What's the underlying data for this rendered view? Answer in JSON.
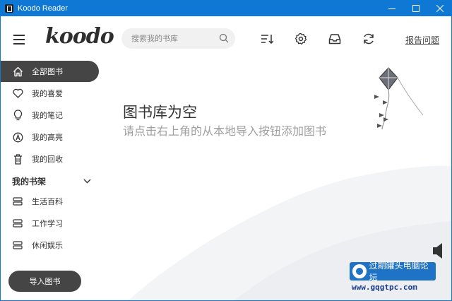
{
  "window": {
    "title": "Koodo Reader"
  },
  "header": {
    "logo": "koodo",
    "search_placeholder": "搜索我的书库",
    "report_label": "报告问题"
  },
  "sidebar": {
    "items": [
      {
        "label": "全部图书",
        "icon": "home-icon",
        "active": true
      },
      {
        "label": "我的喜爱",
        "icon": "heart-icon"
      },
      {
        "label": "我的笔记",
        "icon": "lightbulb-icon"
      },
      {
        "label": "我的高亮",
        "icon": "highlighter-icon"
      },
      {
        "label": "我的回收",
        "icon": "trash-icon"
      }
    ],
    "shelf_title": "我的书架",
    "shelves": [
      {
        "label": "生活百科",
        "icon": "shelf-icon"
      },
      {
        "label": "工作学习",
        "icon": "shelf-icon"
      },
      {
        "label": "休闲娱乐",
        "icon": "shelf-icon"
      }
    ],
    "import_label": "导入图书"
  },
  "empty_state": {
    "title": "图书库为空",
    "subtitle": "请点击右上角的从本地导入按钮添加图书"
  },
  "watermark": {
    "site_name": "过期罐头电脑论坛",
    "url": "www.gqgtpc.com"
  },
  "colors": {
    "titlebar": "#0f78d4",
    "active": "#454545",
    "muted_text": "#a0a0a0"
  }
}
